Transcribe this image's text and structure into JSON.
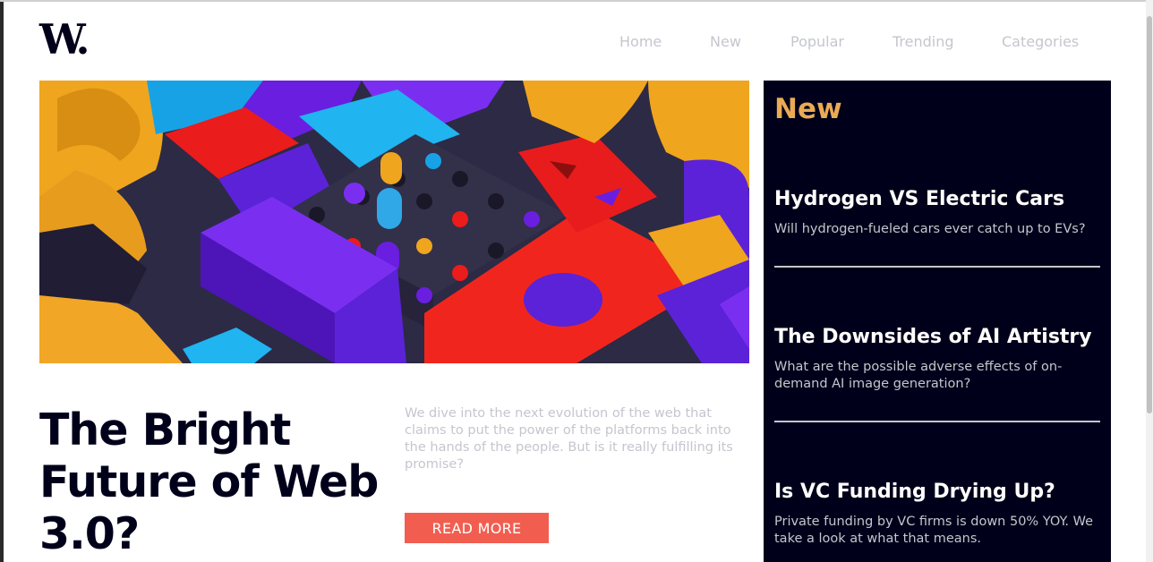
{
  "logo": {
    "text": "W."
  },
  "nav": {
    "items": [
      "Home",
      "New",
      "Popular",
      "Trending",
      "Categories"
    ]
  },
  "hero": {
    "image_description": "abstract 3D colorful blocks",
    "title": "The Bright Future of Web 3.0?",
    "description": "We dive into the next evolution of the web that claims to put the power of the platforms back into the hands of the people. But is it really fulfilling its promise?",
    "button_label": "READ MORE"
  },
  "new_panel": {
    "heading": "New",
    "articles": [
      {
        "title": "Hydrogen VS Electric Cars",
        "summary": "Will hydrogen-fueled cars ever catch up to EVs?"
      },
      {
        "title": "The Downsides of AI Artistry",
        "summary": "What are the possible adverse effects of on-demand AI image generation?"
      },
      {
        "title": "Is VC Funding Drying Up?",
        "summary": "Private funding by VC firms is down 50% YOY. We take a look at what that means."
      }
    ]
  },
  "colors": {
    "dark_blue": "#00001a",
    "soft_orange": "#e9ab53",
    "soft_red": "#f15e50",
    "grayish_blue": "#c5c6ce"
  }
}
